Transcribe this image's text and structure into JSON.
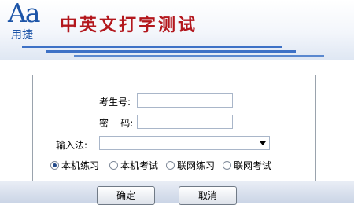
{
  "header": {
    "logo_main": "Aa",
    "logo_sub": "用捷",
    "title": "中英文打字测试"
  },
  "form": {
    "exam_number_label": "考生号:",
    "exam_number_value": "",
    "password_label": "密    码:",
    "password_value": "",
    "input_method_label": "输入法:",
    "input_method_value": "",
    "modes": [
      {
        "label": "本机练习",
        "selected": true
      },
      {
        "label": "本机考试",
        "selected": false
      },
      {
        "label": "联网练习",
        "selected": false
      },
      {
        "label": "联网考试",
        "selected": false
      }
    ]
  },
  "buttons": {
    "ok_label": "确定",
    "cancel_label": "取消"
  },
  "colors": {
    "title": "#b3171d",
    "logo": "#1d55a8",
    "stripe": "#3d71c6"
  }
}
